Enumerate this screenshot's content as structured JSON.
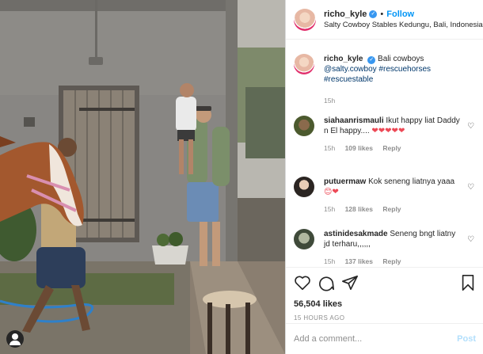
{
  "header": {
    "username": "richo_kyle",
    "follow_label": "Follow",
    "separator": "•",
    "location": "Salty Cowboy Stables Kedungu, Bali, Indonesia",
    "more_icon": "more-horizontal-icon"
  },
  "caption": {
    "username": "richo_kyle",
    "text": "Bali cowboys",
    "tags": "@salty.cowboy #rescuehorses #rescuestable",
    "time": "15h"
  },
  "comments": [
    {
      "username": "siahaanrismauli",
      "text": "Ikut happy liat Daddy n El happy....",
      "emoji": "❤❤❤❤❤",
      "time": "15h",
      "likes": "109 likes",
      "reply": "Reply"
    },
    {
      "username": "putuermaw",
      "text": "Kok seneng liatnya yaaa",
      "emoji": "😊❤",
      "time": "15h",
      "likes": "128 likes",
      "reply": "Reply"
    },
    {
      "username": "astinidesakmade",
      "text": "Seneng bngt liatny jd terharu,,,,,,",
      "emoji": "",
      "time": "15h",
      "likes": "137 likes",
      "reply": "Reply"
    }
  ],
  "actions": {
    "likes": "56,504 likes",
    "timestamp": "15 HOURS AGO"
  },
  "add_comment": {
    "placeholder": "Add a comment...",
    "post_label": "Post"
  },
  "colors": {
    "accent": "#0095f6",
    "verified": "#3897f0",
    "heart": "#ed4956",
    "muted": "#8e8e8e"
  }
}
